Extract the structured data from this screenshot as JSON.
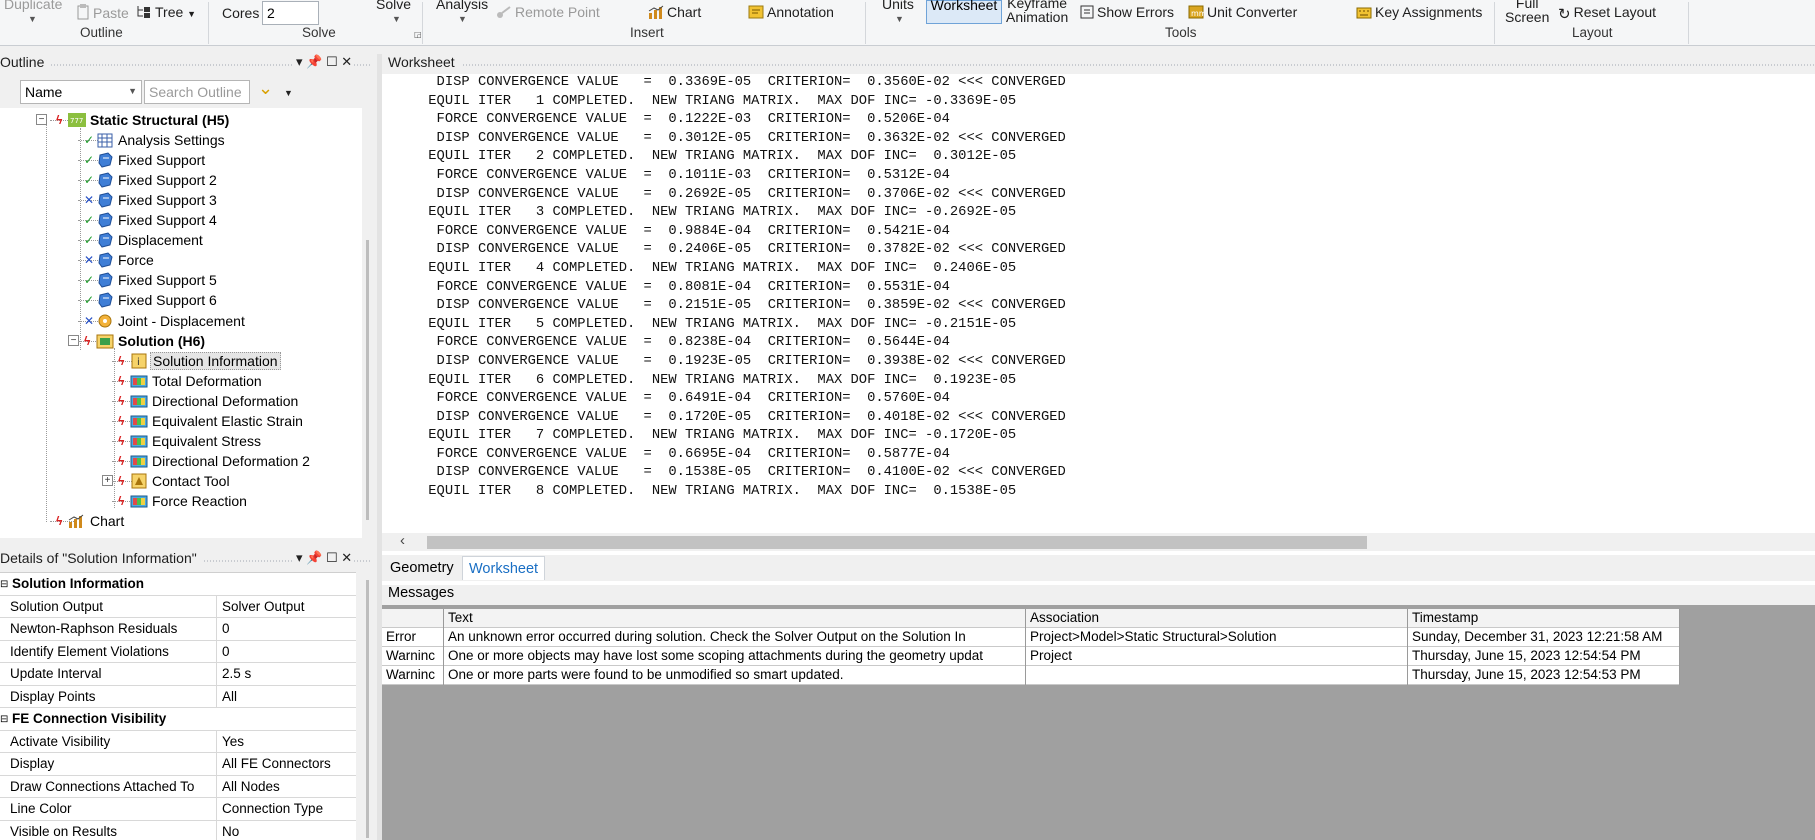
{
  "ribbon": {
    "duplicate": "Duplicate",
    "paste": "Paste",
    "tree": "Tree",
    "outline_group": "Outline",
    "cores_label": "Cores",
    "cores_value": "2",
    "solve": "Solve",
    "solve_group": "Solve",
    "analysis": "Analysis",
    "remote_point": "Remote Point",
    "chart": "Chart",
    "annotation": "Annotation",
    "insert_group": "Insert",
    "units": "Units",
    "worksheet": "Worksheet",
    "keyframe_line1": "Keyframe",
    "keyframe_line2": "Animation",
    "show_errors": "Show Errors",
    "unit_converter": "Unit Converter",
    "key_assignments": "Key Assignments",
    "tools_group": "Tools",
    "full_line1": "Full",
    "full_line2": "Screen",
    "reset_layout": "Reset Layout",
    "layout_group": "Layout"
  },
  "outline": {
    "title": "Outline",
    "filter_select": "Name",
    "search_placeholder": "Search Outline",
    "items": [
      {
        "label": "Static Structural (H5)",
        "status": "bolt"
      },
      {
        "label": "Analysis Settings",
        "status": "check"
      },
      {
        "label": "Fixed Support",
        "status": "check"
      },
      {
        "label": "Fixed Support 2",
        "status": "check"
      },
      {
        "label": "Fixed Support 3",
        "status": "cross"
      },
      {
        "label": "Fixed Support 4",
        "status": "check"
      },
      {
        "label": "Displacement",
        "status": "check"
      },
      {
        "label": "Force",
        "status": "cross"
      },
      {
        "label": "Fixed Support 5",
        "status": "check"
      },
      {
        "label": "Fixed Support 6",
        "status": "check"
      },
      {
        "label": "Joint - Displacement",
        "status": "cross"
      },
      {
        "label": "Solution (H6)",
        "status": "bolt"
      },
      {
        "label": "Solution Information",
        "status": "bolt"
      },
      {
        "label": "Total Deformation",
        "status": "bolt"
      },
      {
        "label": "Directional Deformation",
        "status": "bolt"
      },
      {
        "label": "Equivalent Elastic Strain",
        "status": "bolt"
      },
      {
        "label": "Equivalent Stress",
        "status": "bolt"
      },
      {
        "label": "Directional Deformation 2",
        "status": "bolt"
      },
      {
        "label": "Contact Tool",
        "status": "bolt"
      },
      {
        "label": "Force Reaction",
        "status": "bolt"
      },
      {
        "label": "Chart",
        "status": "bolt"
      }
    ]
  },
  "details": {
    "title": "Details of \"Solution Information\"",
    "rows": [
      {
        "key": "Solution Information",
        "value": "",
        "header": true
      },
      {
        "key": "Solution Output",
        "value": "Solver Output"
      },
      {
        "key": "Newton-Raphson Residuals",
        "value": "0"
      },
      {
        "key": "Identify Element Violations",
        "value": "0"
      },
      {
        "key": "Update Interval",
        "value": "2.5 s"
      },
      {
        "key": "Display Points",
        "value": "All"
      },
      {
        "key": "FE Connection Visibility",
        "value": "",
        "header": true
      },
      {
        "key": "Activate Visibility",
        "value": "Yes"
      },
      {
        "key": "Display",
        "value": "All FE Connectors"
      },
      {
        "key": "Draw Connections Attached To",
        "value": "All Nodes"
      },
      {
        "key": "Line Color",
        "value": "Connection Type"
      },
      {
        "key": "Visible on Results",
        "value": "No"
      }
    ]
  },
  "worksheet": {
    "title": "Worksheet",
    "lines": [
      "  DISP CONVERGENCE VALUE   =  0.3369E-05  CRITERION=  0.3560E-02 <<< CONVERGED",
      " EQUIL ITER   1 COMPLETED.  NEW TRIANG MATRIX.  MAX DOF INC= -0.3369E-05",
      "  FORCE CONVERGENCE VALUE  =  0.1222E-03  CRITERION=  0.5206E-04",
      "  DISP CONVERGENCE VALUE   =  0.3012E-05  CRITERION=  0.3632E-02 <<< CONVERGED",
      " EQUIL ITER   2 COMPLETED.  NEW TRIANG MATRIX.  MAX DOF INC=  0.3012E-05",
      "  FORCE CONVERGENCE VALUE  =  0.1011E-03  CRITERION=  0.5312E-04",
      "  DISP CONVERGENCE VALUE   =  0.2692E-05  CRITERION=  0.3706E-02 <<< CONVERGED",
      " EQUIL ITER   3 COMPLETED.  NEW TRIANG MATRIX.  MAX DOF INC= -0.2692E-05",
      "  FORCE CONVERGENCE VALUE  =  0.9884E-04  CRITERION=  0.5421E-04",
      "  DISP CONVERGENCE VALUE   =  0.2406E-05  CRITERION=  0.3782E-02 <<< CONVERGED",
      " EQUIL ITER   4 COMPLETED.  NEW TRIANG MATRIX.  MAX DOF INC=  0.2406E-05",
      "  FORCE CONVERGENCE VALUE  =  0.8081E-04  CRITERION=  0.5531E-04",
      "  DISP CONVERGENCE VALUE   =  0.2151E-05  CRITERION=  0.3859E-02 <<< CONVERGED",
      " EQUIL ITER   5 COMPLETED.  NEW TRIANG MATRIX.  MAX DOF INC= -0.2151E-05",
      "  FORCE CONVERGENCE VALUE  =  0.8238E-04  CRITERION=  0.5644E-04",
      "  DISP CONVERGENCE VALUE   =  0.1923E-05  CRITERION=  0.3938E-02 <<< CONVERGED",
      " EQUIL ITER   6 COMPLETED.  NEW TRIANG MATRIX.  MAX DOF INC=  0.1923E-05",
      "  FORCE CONVERGENCE VALUE  =  0.6491E-04  CRITERION=  0.5760E-04",
      "  DISP CONVERGENCE VALUE   =  0.1720E-05  CRITERION=  0.4018E-02 <<< CONVERGED",
      " EQUIL ITER   7 COMPLETED.  NEW TRIANG MATRIX.  MAX DOF INC= -0.1720E-05",
      "  FORCE CONVERGENCE VALUE  =  0.6695E-04  CRITERION=  0.5877E-04",
      "  DISP CONVERGENCE VALUE   =  0.1538E-05  CRITERION=  0.4100E-02 <<< CONVERGED",
      " EQUIL ITER   8 COMPLETED.  NEW TRIANG MATRIX.  MAX DOF INC=  0.1538E-05"
    ]
  },
  "view_tabs": {
    "geometry": "Geometry",
    "worksheet": "Worksheet"
  },
  "messages": {
    "title": "Messages",
    "columns": [
      "Text",
      "Association",
      "Timestamp"
    ],
    "rows": [
      {
        "type": "Error",
        "text": "An unknown error occurred during solution.  Check the Solver Output on the Solution In",
        "association": "Project>Model>Static Structural>Solution",
        "timestamp": "Sunday, December 31, 2023 12:21:58 AM"
      },
      {
        "type": "Warninc",
        "text": "One or more objects may have lost some scoping attachments during the geometry updat",
        "association": "Project",
        "timestamp": "Thursday, June 15, 2023 12:54:54 PM"
      },
      {
        "type": "Warninc",
        "text": "One or more parts were found to be unmodified so smart updated.",
        "association": "",
        "timestamp": "Thursday, June 15, 2023 12:54:53 PM"
      }
    ]
  },
  "colors": {
    "check": "#1f9d2b",
    "cross": "#2650c6",
    "bolt": "#d92020",
    "accent": "#1a6fc4"
  }
}
